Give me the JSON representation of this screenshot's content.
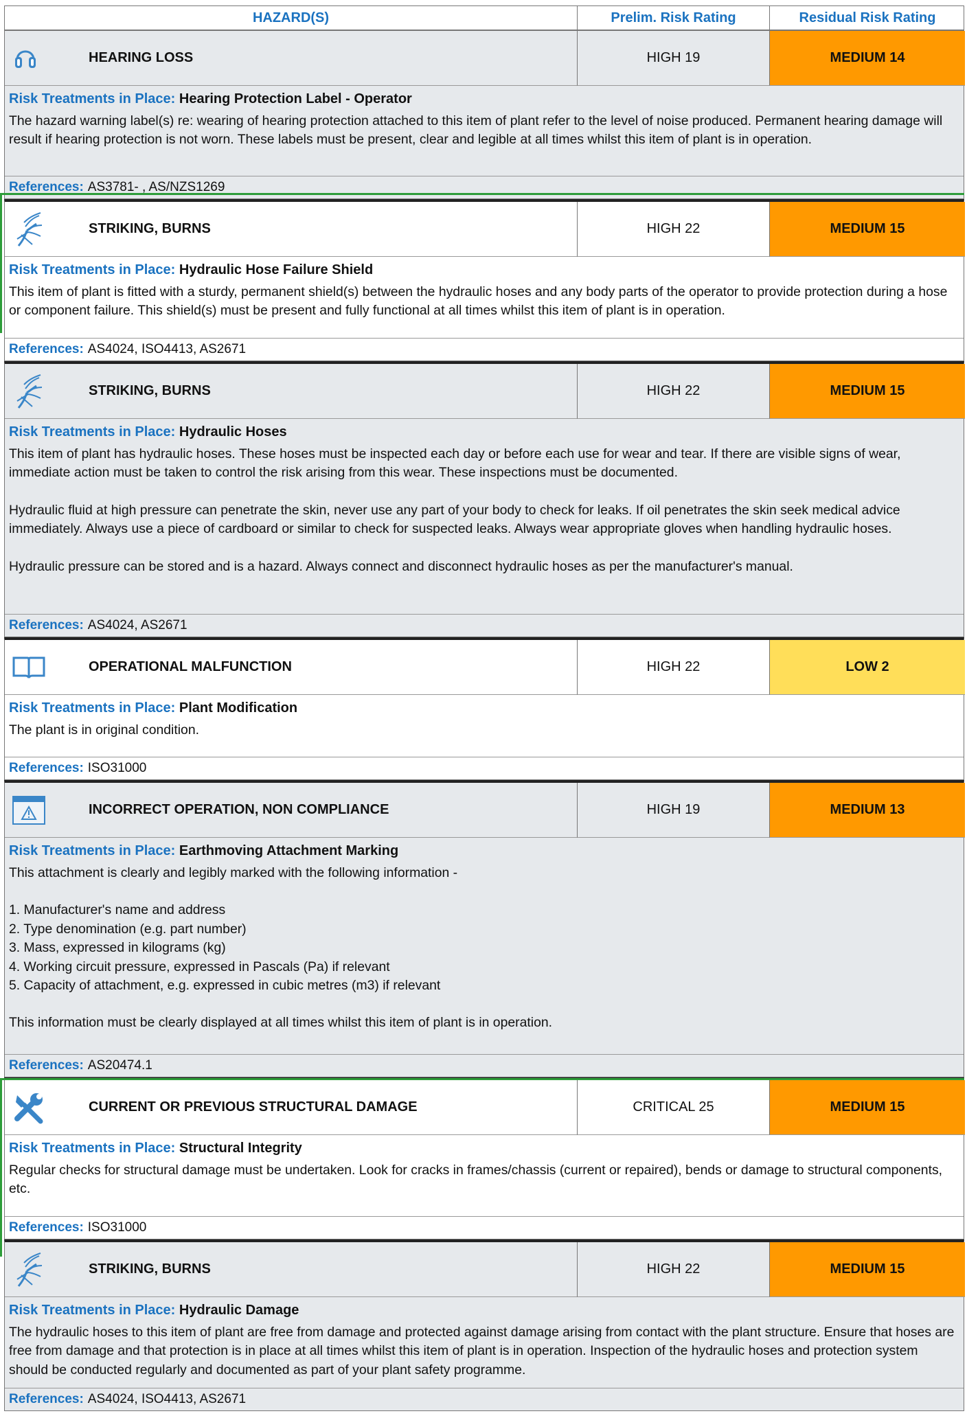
{
  "header": {
    "hazards": "HAZARD(S)",
    "prelim": "Prelim. Risk Rating",
    "residual": "Residual Risk Rating"
  },
  "labels": {
    "treatments": "Risk Treatments in Place:",
    "references": "References:"
  },
  "colors": {
    "accent_blue": "#1a72c0",
    "medium_orange": "#ff9900",
    "low_yellow": "#ffde59",
    "row_gray": "#e6e9ec",
    "marker_green": "#2e9d3a"
  },
  "entries": [
    {
      "icon": "ear-protection-icon",
      "hazard": "HEARING LOSS",
      "prelim": "HIGH 19",
      "residual": "MEDIUM 14",
      "treatment": "Hearing Protection Label - Operator",
      "paragraphs": [
        "The hazard warning label(s) re: wearing of hearing protection attached to this item of plant refer to the level of noise produced. Permanent hearing damage will result if hearing protection is not worn. These labels must be present, clear and legible at all times whilst this item of plant is in operation."
      ],
      "references": "AS3781- , AS/NZS1269"
    },
    {
      "icon": "hydraulic-spray-icon",
      "hazard": "STRIKING, BURNS",
      "prelim": "HIGH 22",
      "residual": "MEDIUM 15",
      "treatment": "Hydraulic Hose Failure Shield",
      "paragraphs": [
        "This item of plant is fitted with a sturdy, permanent shield(s) between the hydraulic hoses and any body parts of the operator to provide protection during a hose or component failure. This shield(s) must be present and fully functional at all times whilst this item of plant is in operation."
      ],
      "references": "AS4024, ISO4413, AS2671"
    },
    {
      "icon": "hydraulic-spray-icon",
      "hazard": "STRIKING, BURNS",
      "prelim": "HIGH 22",
      "residual": "MEDIUM 15",
      "treatment": "Hydraulic Hoses",
      "paragraphs": [
        "This item of plant has hydraulic hoses. These hoses must be inspected each day or before each use for wear and tear. If there are visible signs of wear, immediate action must be taken to control the risk arising from this wear. These inspections must be documented.",
        "Hydraulic fluid at high pressure can penetrate the skin, never use any part of your body to check for leaks. If oil penetrates the skin seek medical advice immediately. Always use a piece of cardboard or similar to check for suspected leaks. Always wear appropriate gloves when handling hydraulic hoses.",
        "Hydraulic pressure can be stored and is a hazard. Always connect and disconnect hydraulic hoses as per the manufacturer's manual."
      ],
      "references": "AS4024, AS2671"
    },
    {
      "icon": "manual-book-icon",
      "hazard": "OPERATIONAL MALFUNCTION",
      "prelim": "HIGH 22",
      "residual": "LOW 2",
      "treatment": "Plant Modification",
      "paragraphs": [
        "The plant is in original condition."
      ],
      "references": "ISO31000"
    },
    {
      "icon": "warning-window-icon",
      "hazard": "INCORRECT OPERATION, NON COMPLIANCE",
      "prelim": "HIGH 19",
      "residual": "MEDIUM 13",
      "treatment": "Earthmoving Attachment Marking",
      "paragraphs": [
        "This attachment is clearly and legibly marked with the following information -",
        "1. Manufacturer's name and address\n2. Type denomination (e.g. part number)\n3. Mass, expressed in kilograms (kg)\n4. Working circuit pressure, expressed in Pascals (Pa) if relevant\n5. Capacity of attachment, e.g. expressed in cubic metres (m3) if relevant",
        "This information must be clearly displayed at all times whilst this item of plant is in operation."
      ],
      "references": "AS20474.1"
    },
    {
      "icon": "wrench-screwdriver-icon",
      "hazard": "CURRENT OR PREVIOUS STRUCTURAL DAMAGE",
      "prelim": "CRITICAL 25",
      "residual": "MEDIUM 15",
      "treatment": "Structural Integrity",
      "paragraphs": [
        "Regular checks for structural damage must be undertaken. Look for cracks in frames/chassis (current or repaired), bends or damage to structural components, etc."
      ],
      "references": "ISO31000"
    },
    {
      "icon": "hydraulic-spray-icon",
      "hazard": "STRIKING, BURNS",
      "prelim": "HIGH 22",
      "residual": "MEDIUM 15",
      "treatment": "Hydraulic Damage",
      "paragraphs": [
        "The hydraulic hoses to this item of plant are free from damage and protected against damage arising from contact with the plant structure. Ensure that hoses are free from damage and that  protection is in place at all times whilst this item of plant is in operation. Inspection of the hydraulic hoses and  protection system should be conducted regularly and documented as part of your plant safety programme."
      ],
      "references": "AS4024, ISO4413, AS2671"
    }
  ]
}
